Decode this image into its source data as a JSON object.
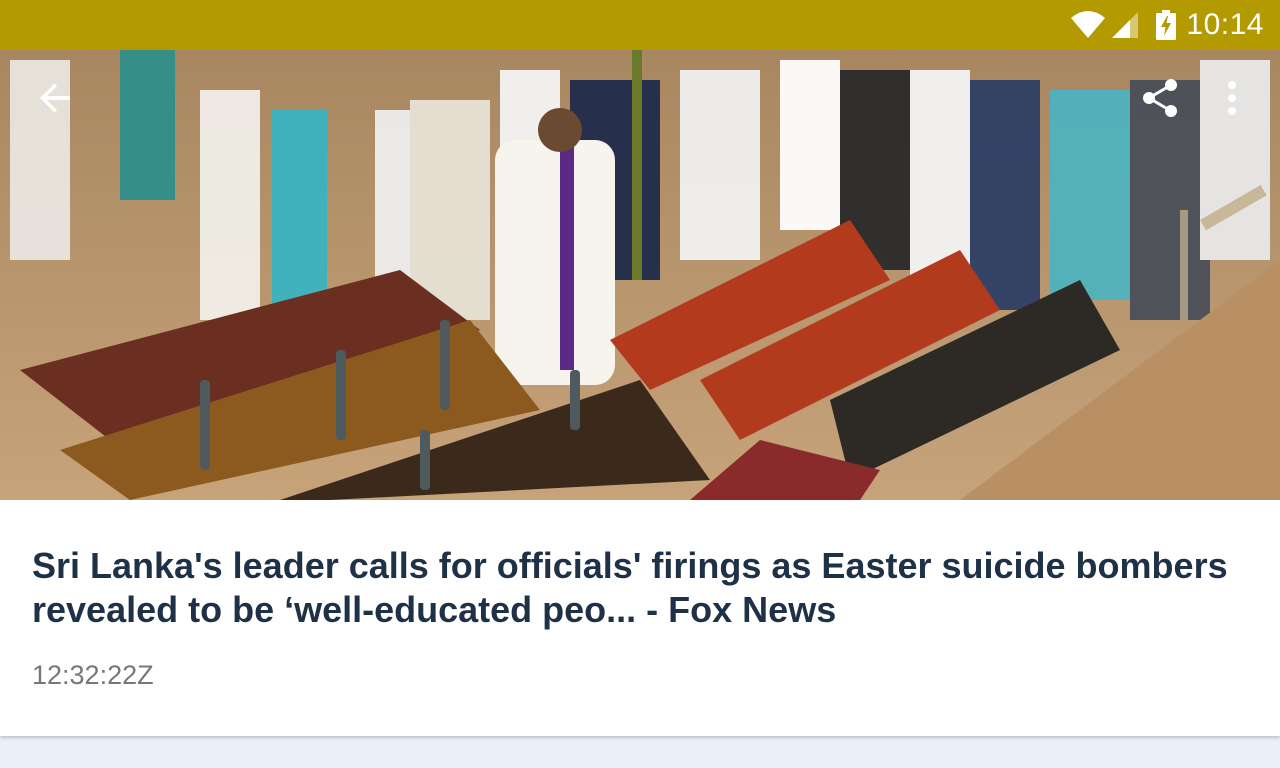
{
  "status_bar": {
    "time": "10:14",
    "background_color": "#b39a00",
    "icons": [
      "wifi-icon",
      "cell-signal-icon",
      "battery-charging-icon"
    ]
  },
  "toolbar": {
    "back_icon": "arrow-back-icon",
    "share_icon": "share-icon",
    "more_icon": "more-vertical-icon"
  },
  "hero_image": {
    "alt": ""
  },
  "article": {
    "headline": "Sri Lanka's leader calls for officials' firings as Easter suicide bombers revealed to be ‘well-educated peo... - Fox News",
    "timestamp": "12:32:22Z",
    "headline_color": "#1f3146"
  }
}
